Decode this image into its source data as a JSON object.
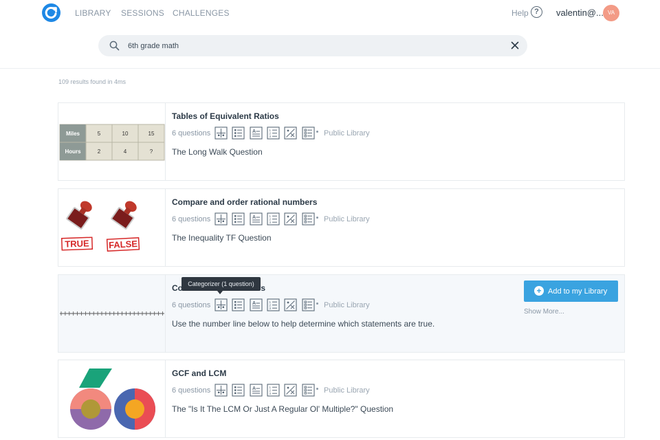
{
  "nav": {
    "items": [
      "LIBRARY",
      "SESSIONS",
      "CHALLENGES"
    ],
    "help_label": "Help",
    "username": "valentin@...",
    "avatar_initials": "VA"
  },
  "search": {
    "value": "6th grade math"
  },
  "results_count": "109 results found in 4ms",
  "cards": [
    {
      "title": "Tables of Equivalent Ratios",
      "question_count": "6 questions",
      "library": "Public Library",
      "description": "The Long Walk Question",
      "table": {
        "rows": [
          {
            "header": "Miles",
            "values": [
              "5",
              "10",
              "15"
            ]
          },
          {
            "header": "Hours",
            "values": [
              "2",
              "4",
              "?"
            ]
          }
        ]
      }
    },
    {
      "title": "Compare and order rational numbers",
      "question_count": "6 questions",
      "library": "Public Library",
      "description": "The Inequality TF Question",
      "stamp_labels": [
        "TRUE",
        "FALSE"
      ]
    },
    {
      "title": "Compare and Order Numbers",
      "title_visible_start": "Co",
      "title_visible_end": "ers",
      "question_count": "6 questions",
      "library": "Public Library",
      "description": "Use the number line below to help determine which statements are true."
    },
    {
      "title": "GCF and LCM",
      "question_count": "6 questions",
      "library": "Public Library",
      "description": "The \"Is It The LCM Or Just A Regular Ol' Multiple?\" Question"
    }
  ],
  "question_type_icons": [
    "categorizer-icon",
    "multiple-choice-icon",
    "text-entry-icon",
    "ordered-list-icon",
    "matching-icon",
    "checklist-icon"
  ],
  "tooltip": "Categorizer  (1 question)",
  "add_button_label": "Add to my Library",
  "show_more_label": "Show More...",
  "colors": {
    "brand": "#1e88e5",
    "button": "#3aa3e0",
    "avatar": "#f39b86"
  }
}
